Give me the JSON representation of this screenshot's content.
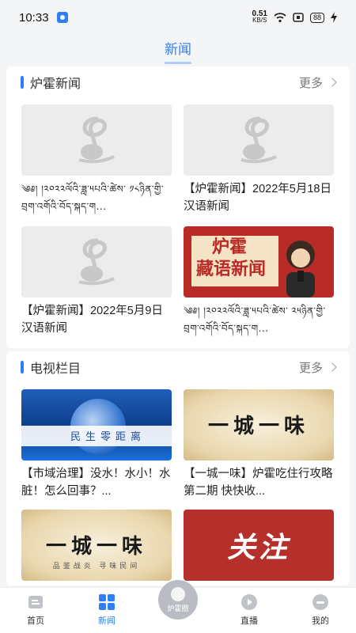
{
  "status": {
    "time": "10:33",
    "speed_value": "0.51",
    "speed_unit": "KB/S",
    "battery": "88"
  },
  "top_tab": {
    "label": "新闻"
  },
  "news_section": {
    "title": "炉霍新闻",
    "more": "更多",
    "items": [
      {
        "caption": "༄༅། །༢༠༢༢ལོའི་ཟླ་༥པའི་ཚེས་ ༡༨ཉིན་གྱི་བྲག་འགོའི་བོད་སྐད་ག...",
        "thumb": "placeholder"
      },
      {
        "caption": "【炉霍新闻】2022年5月18日汉语新闻",
        "thumb": "placeholder"
      },
      {
        "caption": "【炉霍新闻】2022年5月9日汉语新闻",
        "thumb": "placeholder"
      },
      {
        "caption": "༄༅། །༢༠༢༢ལོའི་ཟླ་༥པའི་ཚེས་ ༢༥ཉིན་གྱི་བྲག་འགོའི་བོད་སྐད་ག...",
        "thumb": "red-card",
        "thumb_title_1": "炉霍",
        "thumb_title_2": "藏语新闻"
      }
    ]
  },
  "tv_section": {
    "title": "电视栏目",
    "more": "更多",
    "items": [
      {
        "caption": "【市域治理】没水！水小！水脏！怎么回事？...",
        "thumb": "globe",
        "thumb_text": "民生零距离"
      },
      {
        "caption": "【一城一味】炉霍吃住行攻略第二期 快快收...",
        "thumb": "parchment",
        "thumb_text": "一城一味"
      },
      {
        "caption": "",
        "thumb": "parchment",
        "thumb_text": "一城一味",
        "thumb_sub": "品鉴战炎 寻味民间"
      },
      {
        "caption": "",
        "thumb": "guanzhu",
        "thumb_text": "关注"
      }
    ]
  },
  "bottom_nav": [
    {
      "label": "首页",
      "icon": "home-icon"
    },
    {
      "label": "新闻",
      "icon": "grid-icon",
      "active": true
    },
    {
      "label": "炉霍圈",
      "icon": "circle-icon"
    },
    {
      "label": "直播",
      "icon": "play-icon"
    },
    {
      "label": "我的",
      "icon": "user-icon"
    }
  ],
  "colors": {
    "accent": "#2f7ef5",
    "background": "#f4f5f7",
    "red": "#b92b27"
  }
}
